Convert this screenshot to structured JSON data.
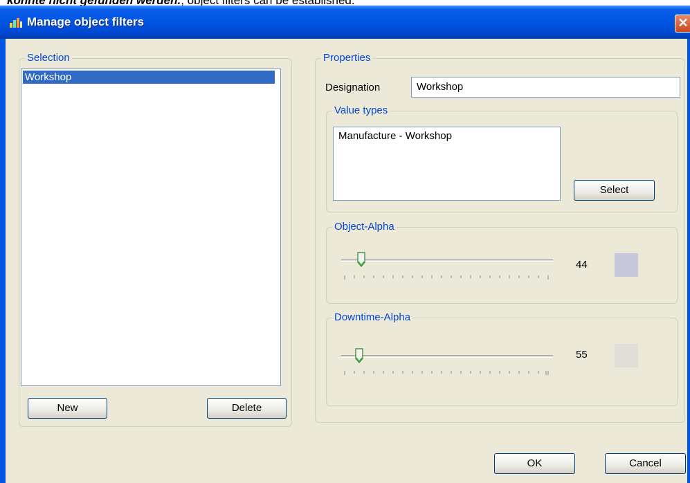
{
  "above_text": {
    "bold": "konnte nicht gefunden werden.",
    "normal": ", object filters can be established."
  },
  "window": {
    "title": "Manage object filters",
    "close_label": "✕"
  },
  "selection": {
    "legend": "Selection",
    "items": [
      "Workshop"
    ],
    "new_label": "New",
    "delete_label": "Delete"
  },
  "properties": {
    "legend": "Properties",
    "designation_label": "Designation",
    "designation_value": "Workshop",
    "value_types": {
      "legend": "Value types",
      "items": [
        "Manufacture - Workshop"
      ],
      "select_label": "Select"
    },
    "object_alpha": {
      "legend": "Object-Alpha",
      "value": "44",
      "swatch_color": "#c8c8dc"
    },
    "downtime_alpha": {
      "legend": "Downtime-Alpha",
      "value": "55",
      "swatch_color": "#e0ded8"
    }
  },
  "footer": {
    "ok_label": "OK",
    "cancel_label": "Cancel"
  },
  "colors": {
    "titlebar": "#0054e3",
    "selection": "#316ac5",
    "legend_text": "#0046d5"
  }
}
